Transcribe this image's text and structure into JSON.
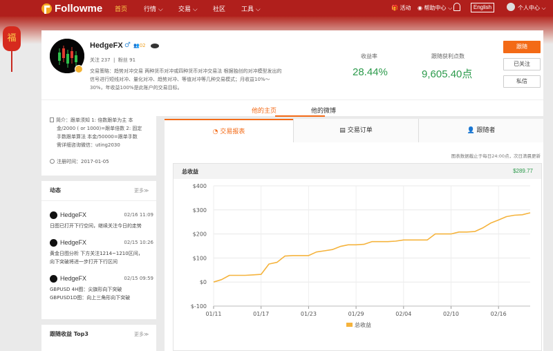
{
  "nav": {
    "logo": "Followme",
    "items": [
      "首页",
      "行情",
      "交易",
      "社区",
      "工具"
    ],
    "activity": "活动",
    "help": "帮助中心",
    "lang": "English",
    "user_center": "个人中心",
    "lantern_char": "福"
  },
  "profile": {
    "name": "HedgeFX",
    "gender_symbol": "♂",
    "badge_count": "02",
    "follow_label": "关注",
    "follow_count": "237",
    "fans_label": "粉丝",
    "fans_count": "91",
    "desc_lines": [
      "交易策略：趋势对冲交易 两种货币对冲或四种货币对冲交易法 根据独创的对冲模型发出的",
      "信号进行短线对冲、量化对冲、趋势对冲、等值对冲等几种交易模式；月收益10%～",
      "30%，年收益100%是此账户的交易目标。"
    ],
    "return_label": "收益率",
    "return_value": "28.44%",
    "points_label": "跟随获利点数",
    "points_value": "9,605.40点",
    "btn_follow": "跟随",
    "btn_followed": "已关注",
    "btn_message": "私信"
  },
  "page_tabs": [
    "他的主页",
    "他的微博"
  ],
  "intro": {
    "lines": [
      "简介：跟单须知 1: 倍数跟单为主 本",
      "金/2000 ( or 1000)=跟单倍数 2: 固定",
      "手数跟单算法 本金/50000=跟单手数",
      "需详细咨询微信：uting2030"
    ],
    "reg": "注册时间：2017-01-05"
  },
  "feed": {
    "title": "动态",
    "more": "更多",
    "items": [
      {
        "user": "HedgeFX",
        "time": "02/16 11:09",
        "lines": [
          "日图已打开下行空间，继续关注今日的走势"
        ]
      },
      {
        "user": "HedgeFX",
        "time": "02/15 10:26",
        "lines": [
          "黄金日图分析 下方关注1214~1210区间，",
          "向下突破将进一步打开下行区间"
        ]
      },
      {
        "user": "HedgeFX",
        "time": "02/15 09:59",
        "lines": [
          "GBPUSD 4H图：尖旗形向下突破",
          "GBPUSD1D图：向上三角形向下突破"
        ]
      }
    ]
  },
  "top3": {
    "title": "跟随收益 Top3",
    "more": "更多"
  },
  "subtabs": [
    "交易报表",
    "交易订单",
    "跟随者"
  ],
  "note": "图表数据截止于每日24:00点，次日清晨更新",
  "panel": {
    "title": "总收益",
    "total": "$289.77"
  },
  "colors": {
    "nav": "#b01f1c",
    "accent": "#f36a16",
    "green": "#2b9a4b",
    "line": "#f5b33c"
  },
  "chart_data": {
    "type": "line",
    "title": "总收益",
    "x_tick_labels": [
      "01/11",
      "01/17",
      "01/23",
      "01/29",
      "02/04",
      "02/10",
      "02/16"
    ],
    "y_tick_labels": [
      "$400",
      "$300",
      "$200",
      "$100",
      "$0",
      "$-100"
    ],
    "ylim": [
      -100,
      400
    ],
    "grid": true,
    "legend": "bottom-center",
    "series": [
      {
        "name": "总收益",
        "x": [
          "01/11",
          "01/12",
          "01/13",
          "01/14",
          "01/15",
          "01/16",
          "01/17",
          "01/18",
          "01/19",
          "01/20",
          "01/21",
          "01/22",
          "01/23",
          "01/24",
          "01/25",
          "01/26",
          "01/27",
          "01/28",
          "01/29",
          "01/30",
          "01/31",
          "02/01",
          "02/02",
          "02/03",
          "02/04",
          "02/05",
          "02/06",
          "02/07",
          "02/08",
          "02/09",
          "02/10",
          "02/11",
          "02/12",
          "02/13",
          "02/14",
          "02/15",
          "02/16",
          "02/17",
          "02/18",
          "02/19",
          "02/20"
        ],
        "values": [
          0,
          10,
          28,
          28,
          28,
          30,
          32,
          75,
          82,
          108,
          110,
          110,
          110,
          125,
          130,
          135,
          148,
          155,
          155,
          157,
          168,
          168,
          168,
          170,
          175,
          175,
          175,
          175,
          200,
          200,
          200,
          208,
          208,
          210,
          225,
          245,
          258,
          272,
          278,
          280,
          288
        ]
      }
    ]
  }
}
